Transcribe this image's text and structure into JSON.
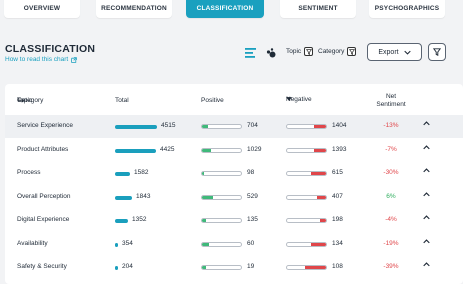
{
  "tabs": [
    {
      "label": "OVERVIEW",
      "active": false
    },
    {
      "label": "RECOMMENDATION",
      "active": false
    },
    {
      "label": "CLASSIFICATION",
      "active": true
    },
    {
      "label": "SENTIMENT",
      "active": false
    },
    {
      "label": "PSYCHOGRAPHICS",
      "active": false
    }
  ],
  "header": {
    "title": "CLASSIFICATION",
    "howto": "How to read this chart"
  },
  "controls": {
    "topic_label": "Topic",
    "category_label": "Category",
    "export_label": "Export"
  },
  "table": {
    "columns": {
      "category": "Category",
      "topic": "Topic",
      "total": "Total",
      "positive": "Positive",
      "negative": "Negative",
      "net_line1": "Net",
      "net_line2": "Sentiment"
    },
    "max_total": 4515,
    "rows": [
      {
        "name": "Service Experience",
        "total": "4515",
        "positive": "704",
        "negative": "1404",
        "net": "-13%",
        "total_value": 4515,
        "pos_frac": 0.16,
        "neg_frac": 0.31
      },
      {
        "name": "Product Attributes",
        "total": "4425",
        "positive": "1029",
        "negative": "1393",
        "net": "-7%",
        "total_value": 4425,
        "pos_frac": 0.23,
        "neg_frac": 0.31
      },
      {
        "name": "Process",
        "total": "1582",
        "positive": "98",
        "negative": "615",
        "net": "-30%",
        "total_value": 1582,
        "pos_frac": 0.06,
        "neg_frac": 0.39
      },
      {
        "name": "Overall Perception",
        "total": "1843",
        "positive": "529",
        "negative": "407",
        "net": "6%",
        "total_value": 1843,
        "pos_frac": 0.29,
        "neg_frac": 0.22
      },
      {
        "name": "Digital Experience",
        "total": "1352",
        "positive": "135",
        "negative": "198",
        "net": "-4%",
        "total_value": 1352,
        "pos_frac": 0.1,
        "neg_frac": 0.15
      },
      {
        "name": "Availability",
        "total": "354",
        "positive": "60",
        "negative": "134",
        "net": "-19%",
        "total_value": 354,
        "pos_frac": 0.17,
        "neg_frac": 0.38
      },
      {
        "name": "Safety & Security",
        "total": "204",
        "positive": "19",
        "negative": "108",
        "net": "-39%",
        "total_value": 204,
        "pos_frac": 0.09,
        "neg_frac": 0.53
      }
    ]
  },
  "colors": {
    "accent": "#1aa0bf",
    "positive_bar": "#3fb97a",
    "negative_bar": "#e0464a",
    "net_negative": "#e0464a",
    "net_positive": "#2fae5e"
  }
}
